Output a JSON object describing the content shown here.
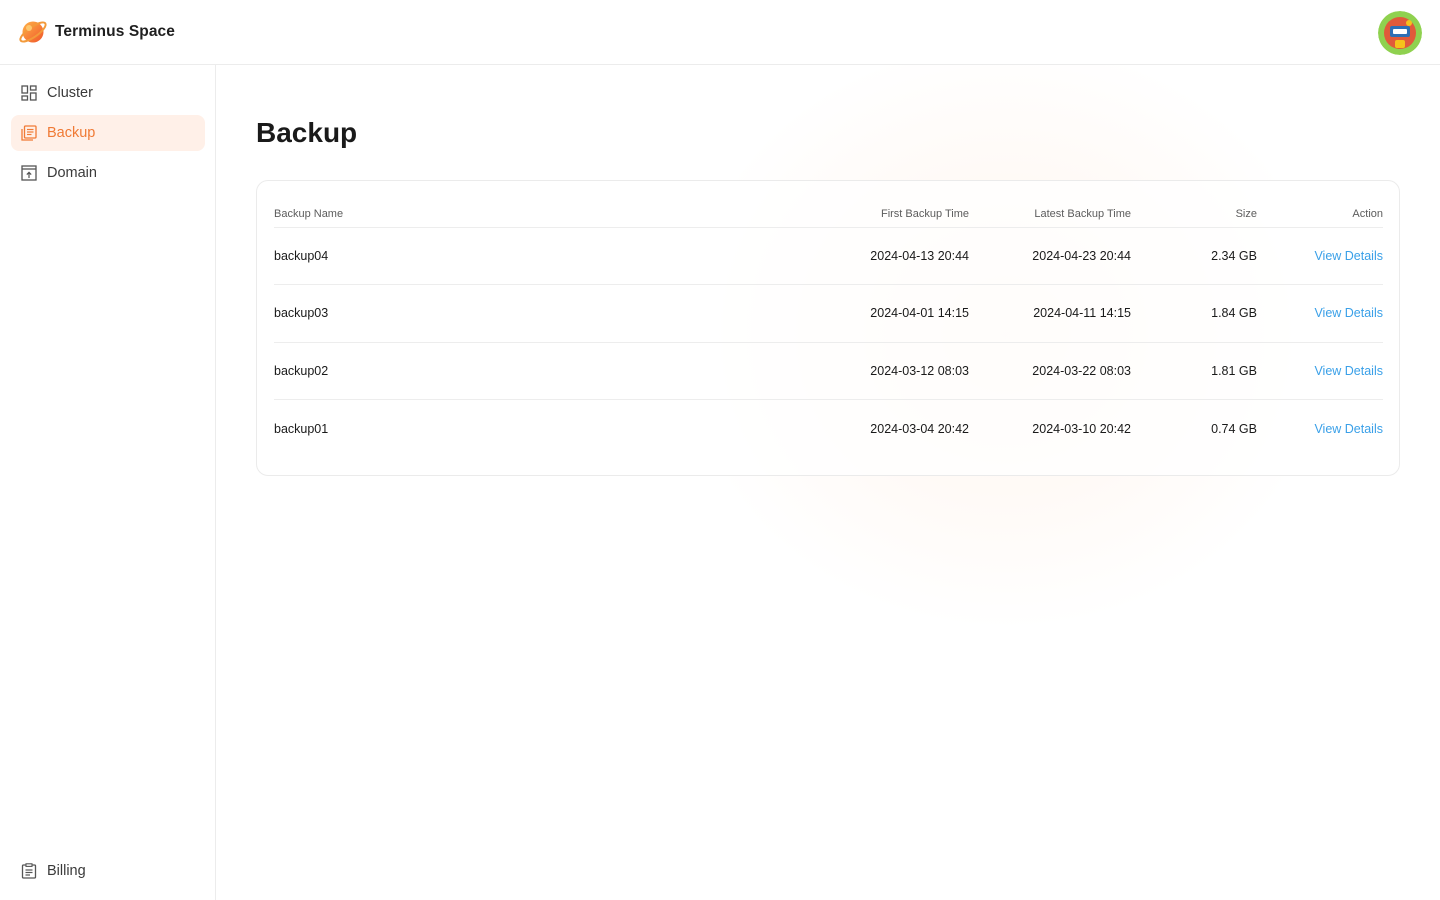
{
  "app": {
    "name": "Terminus Space"
  },
  "sidebar": {
    "items": [
      {
        "label": "Cluster",
        "icon": "grid-icon",
        "active": false
      },
      {
        "label": "Backup",
        "icon": "backup-icon",
        "active": true
      },
      {
        "label": "Domain",
        "icon": "domain-icon",
        "active": false
      }
    ],
    "footer_item": {
      "label": "Billing",
      "icon": "billing-icon"
    }
  },
  "page": {
    "title": "Backup"
  },
  "table": {
    "headers": {
      "name": "Backup Name",
      "first": "First Backup Time",
      "latest": "Latest Backup Time",
      "size": "Size",
      "action": "Action"
    },
    "rows": [
      {
        "name": "backup04",
        "first": "2024-04-13 20:44",
        "latest": "2024-04-23 20:44",
        "size": "2.34 GB",
        "action": "View Details"
      },
      {
        "name": "backup03",
        "first": "2024-04-01 14:15",
        "latest": "2024-04-11 14:15",
        "size": "1.84 GB",
        "action": "View Details"
      },
      {
        "name": "backup02",
        "first": "2024-03-12 08:03",
        "latest": "2024-03-22 08:03",
        "size": "1.81 GB",
        "action": "View Details"
      },
      {
        "name": "backup01",
        "first": "2024-03-04 20:42",
        "latest": "2024-03-10 20:42",
        "size": "0.74 GB",
        "action": "View Details"
      }
    ]
  },
  "colors": {
    "accent": "#f07a35",
    "active_bg": "#fff0e8",
    "link": "#3aa0e8"
  }
}
